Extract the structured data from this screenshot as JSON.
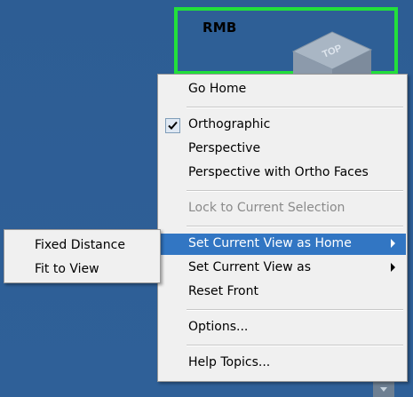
{
  "annotation": {
    "label": "RMB"
  },
  "viewcube": {
    "face_label": "TOP"
  },
  "menu": {
    "go_home": "Go Home",
    "orthographic": "Orthographic",
    "perspective": "Perspective",
    "perspective_ortho_faces": "Perspective with Ortho Faces",
    "lock_selection": "Lock to Current Selection",
    "set_current_view_home": "Set Current View as Home",
    "set_current_view_as": "Set Current View as",
    "reset_front": "Reset Front",
    "options": "Options...",
    "help_topics": "Help Topics..."
  },
  "submenu": {
    "fixed_distance": "Fixed Distance",
    "fit_to_view": "Fit to View"
  },
  "colors": {
    "viewport_bg": "#2e5f96",
    "highlight_border": "#22e03b",
    "menu_bg": "#f0f0f0",
    "menu_highlight": "#3276c3"
  }
}
